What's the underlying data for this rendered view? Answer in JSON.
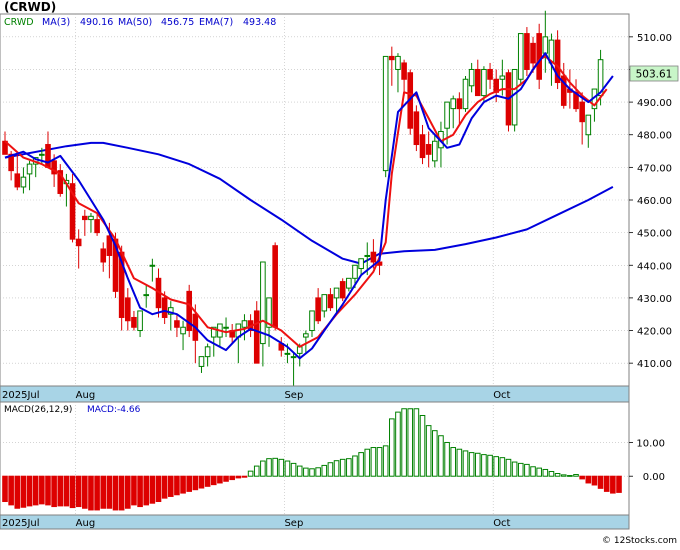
{
  "header": {
    "title": "(CRWD)",
    "legend": [
      {
        "label": "CRWD",
        "color": "#008000"
      },
      {
        "label": "MA(3)",
        "value": "490.16",
        "color": "#0000cc"
      },
      {
        "label": "MA(50)",
        "value": "456.75",
        "color": "#0000cc"
      },
      {
        "label": "EMA(7)",
        "value": "493.48",
        "color": "#0000cc"
      }
    ]
  },
  "last_price_label": "503.61",
  "macd_header": {
    "label": "MACD(26,12,9)",
    "value_label": "MACD:-4.66"
  },
  "footer": "© 12Stocks.com",
  "colors": {
    "up": "#008000",
    "down": "#dd0000",
    "ma_short": "#0000dd",
    "ma_long": "#0000dd",
    "ema": "#ee1111",
    "axis_band": "#a8d4e6",
    "grid": "#bbbbbb"
  },
  "chart_data": [
    {
      "type": "candlestick",
      "ylim": [
        403,
        517
      ],
      "y_ticks": [
        "410.00",
        "420.00",
        "430.00",
        "440.00",
        "450.00",
        "460.00",
        "470.00",
        "480.00",
        "490.00",
        "500.00",
        "510.00"
      ],
      "y_tick_values": [
        410,
        420,
        430,
        440,
        450,
        460,
        470,
        480,
        490,
        500,
        510
      ],
      "x_labels": [
        {
          "label": "2025Jul",
          "index": 0
        },
        {
          "label": "Aug",
          "index": 12
        },
        {
          "label": "Sep",
          "index": 46
        },
        {
          "label": "Oct",
          "index": 80
        }
      ],
      "candles": [
        [
          478,
          481,
          476,
          474
        ],
        [
          474,
          475,
          466,
          469
        ],
        [
          468,
          474,
          463,
          464
        ],
        [
          464,
          470,
          462,
          467
        ],
        [
          468,
          472,
          463,
          471
        ],
        [
          471,
          472,
          467,
          473
        ],
        [
          474,
          476,
          471,
          474
        ],
        [
          477,
          481,
          470,
          470
        ],
        [
          472,
          474,
          464,
          468
        ],
        [
          469,
          471,
          461,
          462
        ],
        [
          465,
          468,
          458,
          466
        ],
        [
          465,
          468,
          447,
          448
        ],
        [
          448,
          451,
          439,
          446
        ],
        [
          455,
          457,
          449,
          454
        ],
        [
          454,
          456,
          450,
          455
        ],
        [
          454,
          456,
          449,
          450
        ],
        [
          445,
          447,
          438,
          441
        ],
        [
          449,
          453,
          436,
          443
        ],
        [
          448,
          450,
          430,
          432
        ],
        [
          444,
          446,
          420,
          424
        ],
        [
          430,
          433,
          420,
          423
        ],
        [
          424,
          426,
          420,
          421
        ],
        [
          420,
          426,
          418,
          426
        ],
        [
          431,
          434,
          427,
          431
        ],
        [
          440,
          442,
          435,
          440
        ],
        [
          436,
          439,
          424,
          427
        ],
        [
          430,
          432,
          422,
          424
        ],
        [
          425,
          429,
          420,
          427
        ],
        [
          423,
          425,
          418,
          421
        ],
        [
          419,
          423,
          414,
          421
        ],
        [
          432,
          434,
          418,
          420
        ],
        [
          425,
          428,
          410,
          417
        ],
        [
          409,
          412,
          407,
          412
        ],
        [
          412,
          416,
          409,
          415
        ],
        [
          418,
          420,
          412,
          421
        ],
        [
          418,
          422,
          415,
          422
        ],
        [
          421,
          424,
          418,
          421
        ],
        [
          420,
          422,
          416,
          418
        ],
        [
          418,
          421,
          410,
          422
        ],
        [
          421,
          425,
          417,
          423
        ],
        [
          423,
          425,
          418,
          420
        ],
        [
          426,
          429,
          410,
          410
        ],
        [
          416,
          430,
          409,
          441
        ],
        [
          421,
          425,
          415,
          430
        ],
        [
          446,
          447,
          420,
          421
        ],
        [
          416,
          418,
          412,
          414
        ],
        [
          413,
          416,
          410,
          413
        ],
        [
          412,
          413,
          403,
          412
        ],
        [
          413,
          416,
          409,
          415
        ],
        [
          418,
          420,
          413,
          419
        ],
        [
          420,
          426,
          418,
          426
        ],
        [
          430,
          433,
          422,
          423
        ],
        [
          426,
          431,
          424,
          431
        ],
        [
          431,
          433,
          426,
          427
        ],
        [
          430,
          433,
          425,
          433
        ],
        [
          435,
          436,
          429,
          430
        ],
        [
          433,
          436,
          432,
          436
        ],
        [
          436,
          440,
          433,
          440
        ],
        [
          439,
          442,
          437,
          442
        ],
        [
          443,
          447,
          437,
          443
        ],
        [
          444,
          448,
          439,
          441
        ],
        [
          441,
          444,
          437,
          440
        ],
        [
          469,
          504,
          467,
          504
        ],
        [
          504,
          507,
          495,
          503
        ],
        [
          500,
          505,
          493,
          504
        ],
        [
          502,
          503,
          492,
          497
        ],
        [
          499,
          500,
          480,
          482
        ],
        [
          487,
          489,
          475,
          477
        ],
        [
          480,
          483,
          471,
          473
        ],
        [
          477,
          481,
          470,
          474
        ],
        [
          472,
          480,
          470,
          478
        ],
        [
          476,
          484,
          470,
          481
        ],
        [
          482,
          490,
          477,
          490
        ],
        [
          488,
          492,
          482,
          491
        ],
        [
          491,
          493,
          483,
          488
        ],
        [
          488,
          498,
          487,
          497
        ],
        [
          495,
          502,
          493,
          500
        ],
        [
          500,
          503,
          492,
          492
        ],
        [
          492,
          501,
          490,
          500
        ],
        [
          500,
          502,
          494,
          497
        ],
        [
          497,
          500,
          490,
          493
        ],
        [
          497,
          503,
          492,
          498
        ],
        [
          499,
          500,
          481,
          483
        ],
        [
          483,
          500,
          481,
          500
        ],
        [
          497,
          511,
          495,
          511
        ],
        [
          511,
          513,
          498,
          500
        ],
        [
          508,
          510,
          499,
          502
        ],
        [
          511,
          514,
          494,
          497
        ],
        [
          505,
          518,
          499,
          510
        ],
        [
          502,
          511,
          495,
          509
        ],
        [
          509,
          512,
          494,
          496
        ],
        [
          498,
          502,
          488,
          489
        ],
        [
          494,
          500,
          488,
          493
        ],
        [
          493,
          497,
          487,
          488
        ],
        [
          490,
          493,
          477,
          484
        ],
        [
          480,
          483,
          476,
          486
        ],
        [
          488,
          492,
          484,
          494
        ],
        [
          492,
          506,
          489,
          503
        ]
      ],
      "series": [
        {
          "name": "MA(50)",
          "values": [
            [
              0,
              473
            ],
            [
              10,
              476.5
            ],
            [
              14,
              477.5
            ],
            [
              16,
              477.5
            ],
            [
              20,
              476
            ],
            [
              25,
              474
            ],
            [
              30,
              471
            ],
            [
              35,
              466.5
            ],
            [
              40,
              460
            ],
            [
              45,
              454
            ],
            [
              50,
              447.5
            ],
            [
              55,
              442
            ],
            [
              58,
              440.5
            ],
            [
              61,
              443.5
            ],
            [
              65,
              444.3
            ],
            [
              70,
              444.7
            ],
            [
              75,
              446.5
            ],
            [
              80,
              448.5
            ],
            [
              85,
              451
            ],
            [
              90,
              455.5
            ],
            [
              95,
              460
            ],
            [
              99,
              464
            ]
          ]
        },
        {
          "name": "EMA(7)",
          "values": [
            [
              0,
              478
            ],
            [
              3,
              473
            ],
            [
              6,
              471
            ],
            [
              9,
              468
            ],
            [
              12,
              459
            ],
            [
              15,
              456
            ],
            [
              18,
              448
            ],
            [
              21,
              436
            ],
            [
              24,
              433
            ],
            [
              27,
              429.5
            ],
            [
              30,
              428
            ],
            [
              33,
              421
            ],
            [
              36,
              419.5
            ],
            [
              39,
              420.5
            ],
            [
              42,
              423
            ],
            [
              45,
              420
            ],
            [
              48,
              415
            ],
            [
              51,
              418
            ],
            [
              54,
              425
            ],
            [
              57,
              431
            ],
            [
              60,
              438
            ],
            [
              62,
              447
            ],
            [
              63,
              468
            ],
            [
              65,
              493
            ],
            [
              67,
              492
            ],
            [
              69,
              485
            ],
            [
              71,
              478
            ],
            [
              73,
              480
            ],
            [
              75,
              486
            ],
            [
              77,
              490
            ],
            [
              79,
              492.5
            ],
            [
              81,
              494
            ],
            [
              83,
              494
            ],
            [
              85,
              497
            ],
            [
              87,
              503
            ],
            [
              88,
              504
            ],
            [
              90,
              501
            ],
            [
              92,
              496
            ],
            [
              94,
              492
            ],
            [
              96,
              489
            ],
            [
              98,
              494
            ]
          ]
        },
        {
          "name": "MA(3)",
          "values": [
            [
              0,
              473
            ],
            [
              3,
              474.8
            ],
            [
              5,
              472.5
            ],
            [
              7,
              471.5
            ],
            [
              9,
              473.5
            ],
            [
              12,
              466
            ],
            [
              14,
              460
            ],
            [
              16,
              454
            ],
            [
              18,
              446
            ],
            [
              20,
              436
            ],
            [
              22,
              427
            ],
            [
              24,
              425
            ],
            [
              26,
              426
            ],
            [
              28,
              425
            ],
            [
              31,
              421
            ],
            [
              33,
              417
            ],
            [
              36,
              414
            ],
            [
              38,
              418
            ],
            [
              40,
              420.5
            ],
            [
              43,
              418.5
            ],
            [
              46,
              415
            ],
            [
              48,
              411.5
            ],
            [
              50,
              414.5
            ],
            [
              52,
              420
            ],
            [
              55,
              428
            ],
            [
              58,
              437
            ],
            [
              61,
              441.5
            ],
            [
              62,
              460
            ],
            [
              64,
              487
            ],
            [
              67,
              493
            ],
            [
              69,
              482
            ],
            [
              72,
              476
            ],
            [
              74,
              477
            ],
            [
              76,
              485
            ],
            [
              78,
              490
            ],
            [
              80,
              492
            ],
            [
              82,
              491
            ],
            [
              84,
              494
            ],
            [
              86,
              500
            ],
            [
              88,
              505
            ],
            [
              90,
              498
            ],
            [
              92,
              494
            ],
            [
              95,
              490
            ],
            [
              97,
              493
            ],
            [
              99,
              498
            ]
          ]
        }
      ]
    },
    {
      "type": "bar",
      "title": "MACD(26,12,9)",
      "ylim": [
        -11.5,
        22
      ],
      "y_ticks": [
        "0.00",
        "10.00"
      ],
      "y_tick_values": [
        0,
        10
      ],
      "x_labels": [
        {
          "label": "2025Jul",
          "index": 0
        },
        {
          "label": "Aug",
          "index": 12
        },
        {
          "label": "Sep",
          "index": 46
        },
        {
          "label": "Oct",
          "index": 80
        }
      ],
      "values": [
        -7.5,
        -8.5,
        -9.5,
        -9.2,
        -8.8,
        -8.5,
        -8.2,
        -8.5,
        -9.0,
        -8.8,
        -8.8,
        -9.3,
        -9.0,
        -9.5,
        -10.0,
        -10.0,
        -9.5,
        -9.5,
        -10.0,
        -10.0,
        -9.5,
        -8.5,
        -9.0,
        -8.5,
        -8.0,
        -7.5,
        -6.5,
        -6.0,
        -5.5,
        -5.0,
        -4.5,
        -4.0,
        -3.5,
        -3.0,
        -2.5,
        -2.0,
        -1.5,
        -1.0,
        -0.5,
        -0.3,
        1.5,
        3.0,
        4.5,
        5.2,
        5.3,
        5.0,
        4.5,
        3.8,
        3.0,
        2.4,
        2.2,
        2.5,
        3.2,
        4.0,
        4.6,
        5.0,
        5.2,
        6.0,
        7.0,
        8.0,
        8.5,
        8.5,
        9.0,
        17.0,
        19.0,
        20.0,
        20.0,
        20.0,
        18.0,
        15.0,
        13.5,
        12.0,
        10.0,
        8.5,
        8.0,
        7.5,
        7.0,
        6.8,
        6.4,
        6.2,
        5.8,
        5.5,
        5.0,
        4.2,
        3.8,
        3.5,
        2.8,
        2.4,
        2.0,
        1.4,
        0.8,
        0.4,
        0.2,
        0.5,
        -0.8,
        -2.0,
        -2.6,
        -3.6,
        -4.5,
        -5.0,
        -4.8
      ]
    }
  ]
}
